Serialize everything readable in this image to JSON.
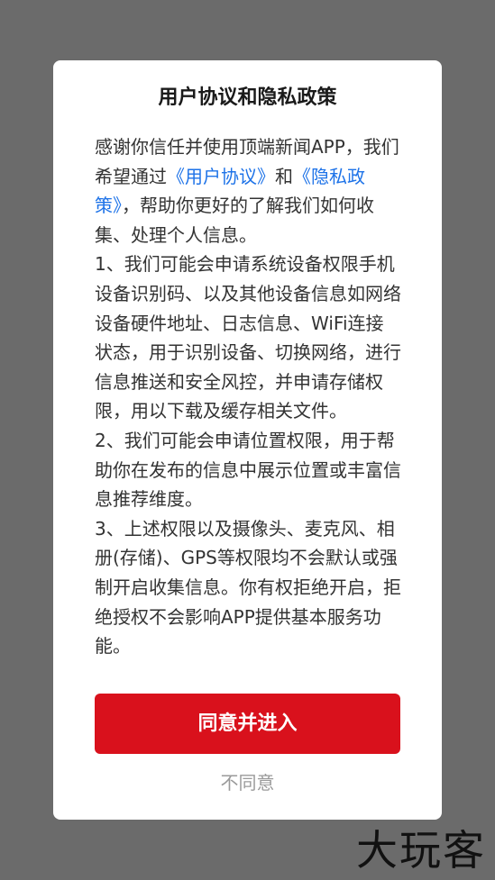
{
  "dialog": {
    "title": "用户协议和隐私政策",
    "intro": {
      "line_prefix": "感谢你信任并使用顶端新闻APP，我们希望通过",
      "user_agreement_link": "《用户协议》",
      "and": "和",
      "privacy_policy_link": "《隐私政策》",
      "line_suffix": "，帮助你更好的了解我们如何收集、处理个人信息。"
    },
    "paragraphs": [
      "1、我们可能会申请系统设备权限手机设备识别码、以及其他设备信息如网络设备硬件地址、日志信息、WiFi连接状态，用于识别设备、切换网络，进行信息推送和安全风控，并申请存储权限，用以下载及缓存相关文件。",
      "2、我们可能会申请位置权限，用于帮助你在发布的信息中展示位置或丰富信息推荐维度。",
      "3、上述权限以及摄像头、麦克风、相册(存储)、GPS等权限均不会默认或强制开启收集信息。你有权拒绝开启，拒绝授权不会影响APP提供基本服务功能。"
    ],
    "agree_label": "同意并进入",
    "disagree_label": "不同意"
  },
  "watermark": {
    "text": "大玩客"
  },
  "colors": {
    "overlay": "#6b6b6b",
    "link": "#1e73e8",
    "primary_button": "#d9111c",
    "secondary_text": "#9a9a9a"
  }
}
